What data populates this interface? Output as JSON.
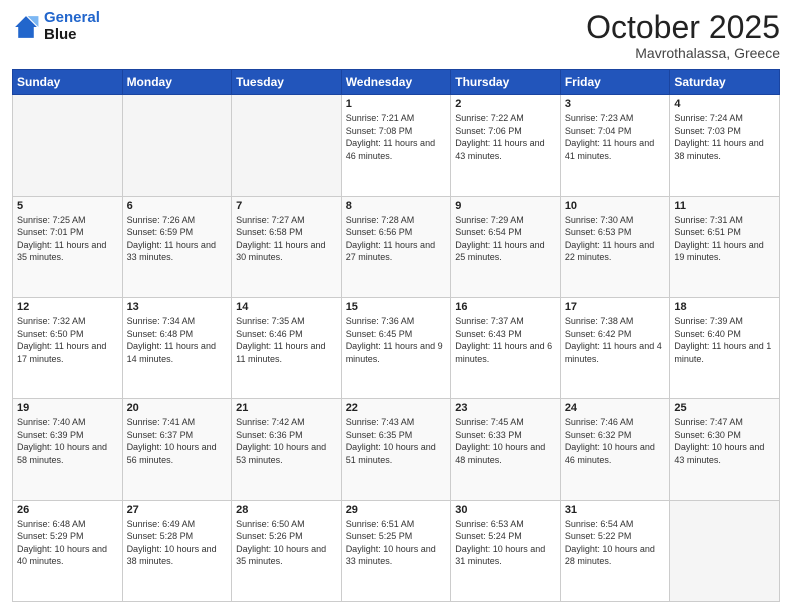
{
  "header": {
    "logo_line1": "General",
    "logo_line2": "Blue",
    "title": "October 2025",
    "subtitle": "Mavrothalassa, Greece"
  },
  "days_of_week": [
    "Sunday",
    "Monday",
    "Tuesday",
    "Wednesday",
    "Thursday",
    "Friday",
    "Saturday"
  ],
  "weeks": [
    [
      {
        "day": "",
        "info": ""
      },
      {
        "day": "",
        "info": ""
      },
      {
        "day": "",
        "info": ""
      },
      {
        "day": "1",
        "info": "Sunrise: 7:21 AM\nSunset: 7:08 PM\nDaylight: 11 hours\nand 46 minutes."
      },
      {
        "day": "2",
        "info": "Sunrise: 7:22 AM\nSunset: 7:06 PM\nDaylight: 11 hours\nand 43 minutes."
      },
      {
        "day": "3",
        "info": "Sunrise: 7:23 AM\nSunset: 7:04 PM\nDaylight: 11 hours\nand 41 minutes."
      },
      {
        "day": "4",
        "info": "Sunrise: 7:24 AM\nSunset: 7:03 PM\nDaylight: 11 hours\nand 38 minutes."
      }
    ],
    [
      {
        "day": "5",
        "info": "Sunrise: 7:25 AM\nSunset: 7:01 PM\nDaylight: 11 hours\nand 35 minutes."
      },
      {
        "day": "6",
        "info": "Sunrise: 7:26 AM\nSunset: 6:59 PM\nDaylight: 11 hours\nand 33 minutes."
      },
      {
        "day": "7",
        "info": "Sunrise: 7:27 AM\nSunset: 6:58 PM\nDaylight: 11 hours\nand 30 minutes."
      },
      {
        "day": "8",
        "info": "Sunrise: 7:28 AM\nSunset: 6:56 PM\nDaylight: 11 hours\nand 27 minutes."
      },
      {
        "day": "9",
        "info": "Sunrise: 7:29 AM\nSunset: 6:54 PM\nDaylight: 11 hours\nand 25 minutes."
      },
      {
        "day": "10",
        "info": "Sunrise: 7:30 AM\nSunset: 6:53 PM\nDaylight: 11 hours\nand 22 minutes."
      },
      {
        "day": "11",
        "info": "Sunrise: 7:31 AM\nSunset: 6:51 PM\nDaylight: 11 hours\nand 19 minutes."
      }
    ],
    [
      {
        "day": "12",
        "info": "Sunrise: 7:32 AM\nSunset: 6:50 PM\nDaylight: 11 hours\nand 17 minutes."
      },
      {
        "day": "13",
        "info": "Sunrise: 7:34 AM\nSunset: 6:48 PM\nDaylight: 11 hours\nand 14 minutes."
      },
      {
        "day": "14",
        "info": "Sunrise: 7:35 AM\nSunset: 6:46 PM\nDaylight: 11 hours\nand 11 minutes."
      },
      {
        "day": "15",
        "info": "Sunrise: 7:36 AM\nSunset: 6:45 PM\nDaylight: 11 hours\nand 9 minutes."
      },
      {
        "day": "16",
        "info": "Sunrise: 7:37 AM\nSunset: 6:43 PM\nDaylight: 11 hours\nand 6 minutes."
      },
      {
        "day": "17",
        "info": "Sunrise: 7:38 AM\nSunset: 6:42 PM\nDaylight: 11 hours\nand 4 minutes."
      },
      {
        "day": "18",
        "info": "Sunrise: 7:39 AM\nSunset: 6:40 PM\nDaylight: 11 hours\nand 1 minute."
      }
    ],
    [
      {
        "day": "19",
        "info": "Sunrise: 7:40 AM\nSunset: 6:39 PM\nDaylight: 10 hours\nand 58 minutes."
      },
      {
        "day": "20",
        "info": "Sunrise: 7:41 AM\nSunset: 6:37 PM\nDaylight: 10 hours\nand 56 minutes."
      },
      {
        "day": "21",
        "info": "Sunrise: 7:42 AM\nSunset: 6:36 PM\nDaylight: 10 hours\nand 53 minutes."
      },
      {
        "day": "22",
        "info": "Sunrise: 7:43 AM\nSunset: 6:35 PM\nDaylight: 10 hours\nand 51 minutes."
      },
      {
        "day": "23",
        "info": "Sunrise: 7:45 AM\nSunset: 6:33 PM\nDaylight: 10 hours\nand 48 minutes."
      },
      {
        "day": "24",
        "info": "Sunrise: 7:46 AM\nSunset: 6:32 PM\nDaylight: 10 hours\nand 46 minutes."
      },
      {
        "day": "25",
        "info": "Sunrise: 7:47 AM\nSunset: 6:30 PM\nDaylight: 10 hours\nand 43 minutes."
      }
    ],
    [
      {
        "day": "26",
        "info": "Sunrise: 6:48 AM\nSunset: 5:29 PM\nDaylight: 10 hours\nand 40 minutes."
      },
      {
        "day": "27",
        "info": "Sunrise: 6:49 AM\nSunset: 5:28 PM\nDaylight: 10 hours\nand 38 minutes."
      },
      {
        "day": "28",
        "info": "Sunrise: 6:50 AM\nSunset: 5:26 PM\nDaylight: 10 hours\nand 35 minutes."
      },
      {
        "day": "29",
        "info": "Sunrise: 6:51 AM\nSunset: 5:25 PM\nDaylight: 10 hours\nand 33 minutes."
      },
      {
        "day": "30",
        "info": "Sunrise: 6:53 AM\nSunset: 5:24 PM\nDaylight: 10 hours\nand 31 minutes."
      },
      {
        "day": "31",
        "info": "Sunrise: 6:54 AM\nSunset: 5:22 PM\nDaylight: 10 hours\nand 28 minutes."
      },
      {
        "day": "",
        "info": ""
      }
    ]
  ]
}
